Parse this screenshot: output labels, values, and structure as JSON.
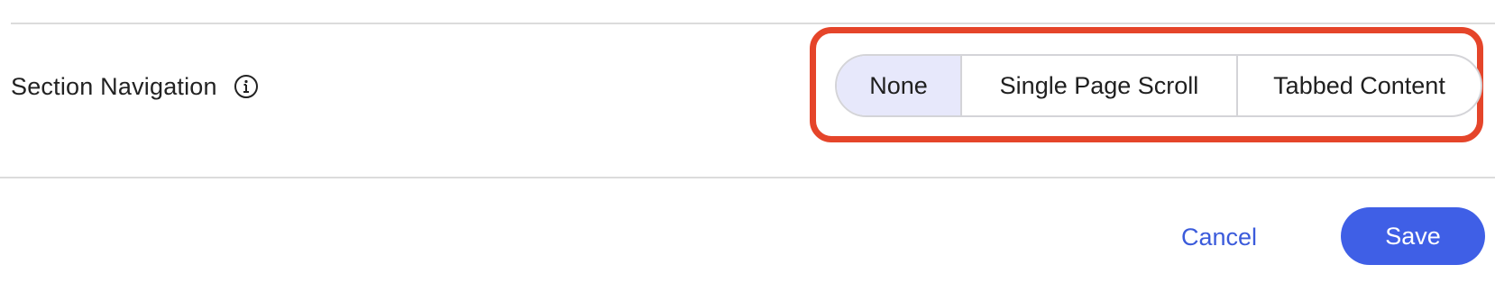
{
  "section_navigation": {
    "label": "Section Navigation",
    "info_icon": "info-circle-icon",
    "options": [
      {
        "label": "None",
        "selected": true
      },
      {
        "label": "Single Page Scroll",
        "selected": false
      },
      {
        "label": "Tabbed Content",
        "selected": false
      }
    ],
    "highlight_color": "#e5452a",
    "selected_bg": "#e7e8fb"
  },
  "footer": {
    "cancel_label": "Cancel",
    "save_label": "Save",
    "accent_color": "#3f5fe6"
  }
}
